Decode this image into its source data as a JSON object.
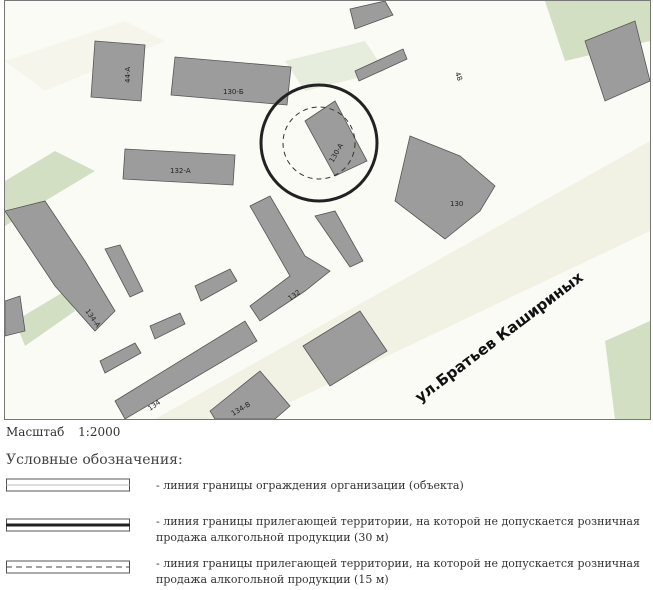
{
  "map": {
    "street_name": "ул.Братьев Кашириных",
    "building_labels": {
      "b130a": "130-А",
      "b130b": "130-Б",
      "b132a": "132-А",
      "b132": "132",
      "b134": "134",
      "b134a": "134-А",
      "b134v": "134-В",
      "b130": "130",
      "b44a": "44-А",
      "n48": "48"
    }
  },
  "scale": {
    "label": "Масштаб",
    "value": "1:2000"
  },
  "legend": {
    "title": "Условные обозначения:",
    "items": [
      {
        "text": "- линия границы ограждения организации (объекта)"
      },
      {
        "text": "- линия границы прилегающей территории, на которой не допускается розничная продажа алкогольной продукции (30 м)"
      },
      {
        "text": "- линия границы прилегающей территории, на которой не допускается розничная продажа алкогольной продукции (15 м)"
      }
    ]
  },
  "colors": {
    "building": "#9a9a9a",
    "green": "#c9d7b8",
    "road": "#f3f3ea"
  }
}
